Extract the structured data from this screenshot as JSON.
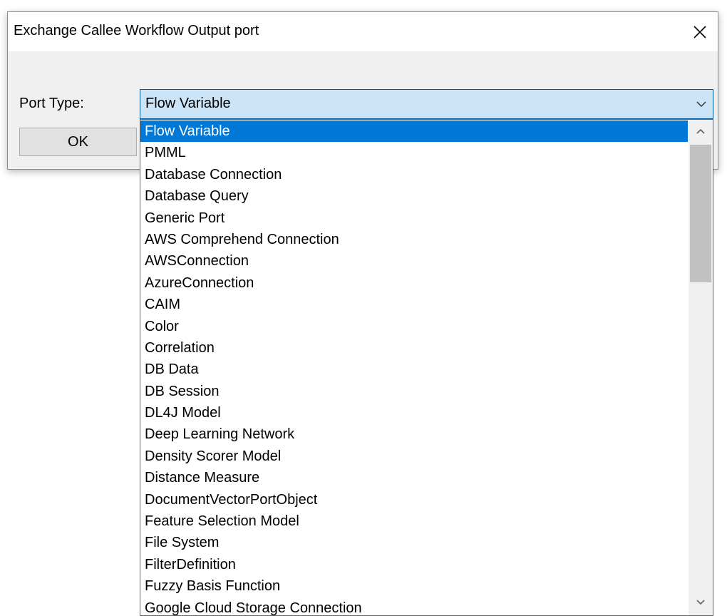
{
  "dialog": {
    "title": "Exchange Callee Workflow Output port",
    "close_icon": "close-icon"
  },
  "form": {
    "port_type_label": "Port Type:",
    "ok_label": "OK"
  },
  "combo": {
    "selected_value": "Flow Variable",
    "arrow_icon": "chevron-down-icon"
  },
  "dropdown": {
    "items": [
      "Flow Variable",
      "PMML",
      "Database Connection",
      "Database Query",
      "Generic Port",
      "AWS Comprehend Connection",
      "AWSConnection",
      "AzureConnection",
      "CAIM",
      "Color",
      "Correlation",
      "DB Data",
      "DB Session",
      "DL4J Model",
      "Deep Learning Network",
      "Density Scorer Model",
      "Distance Measure",
      "DocumentVectorPortObject",
      "Feature Selection Model",
      "File System",
      "FilterDefinition",
      "Fuzzy Basis Function",
      "Google Cloud Storage Connection"
    ],
    "selected_index": 0,
    "scroll_up_icon": "chevron-up-icon",
    "scroll_down_icon": "chevron-down-icon"
  },
  "colors": {
    "selection": "#0078d7",
    "combo_background": "#cce4f7",
    "combo_border": "#005499",
    "dialog_background": "#f0f0f0"
  }
}
